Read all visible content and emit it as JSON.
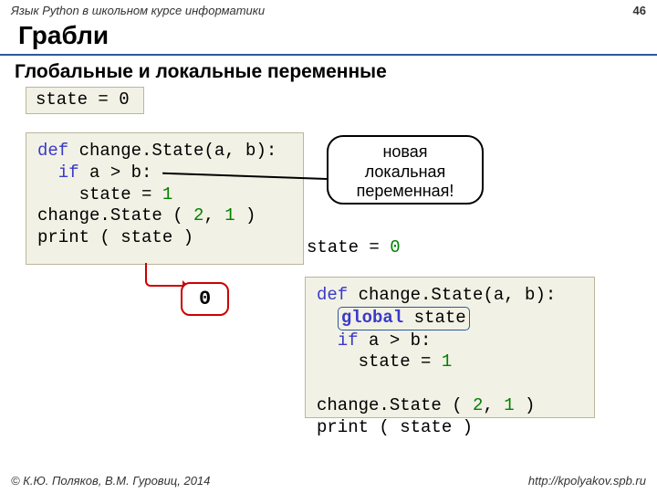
{
  "header": {
    "course": "Язык Python в школьном курсе информатики",
    "page_number": "46"
  },
  "title": "Грабли",
  "subtitle": "Глобальные и локальные переменные",
  "code_left1": "state = 0",
  "code_left2": {
    "l1a": "def",
    "l1b": " change.State(a, b):",
    "l2a": "  if",
    "l2b": " a > b:",
    "l3": "    state = ",
    "l3n": "1",
    "l4": "change.State ( ",
    "l4n1": "2",
    "l4m": ", ",
    "l4n2": "1",
    "l4e": " )",
    "l5": "print ( state )"
  },
  "callout": {
    "line1": "новая",
    "line2": "локальная",
    "line3": "переменная!"
  },
  "result_badge": "0",
  "state_line": {
    "a": "state = ",
    "n": "0"
  },
  "code_right": {
    "l1a": "def",
    "l1b": " change.State(a, b):",
    "l2": "global",
    "l2b": " state",
    "l3a": "  if",
    "l3b": " a > b:",
    "l4": "    state = ",
    "l4n": "1",
    "gap": "",
    "l5": "change.State ( ",
    "l5n1": "2",
    "l5m": ", ",
    "l5n2": "1",
    "l5e": " )",
    "l6": "print ( state )"
  },
  "footer": {
    "copyright": "© К.Ю. Поляков, В.М. Гуровиц, 2014",
    "url": "http://kpolyakov.spb.ru"
  }
}
